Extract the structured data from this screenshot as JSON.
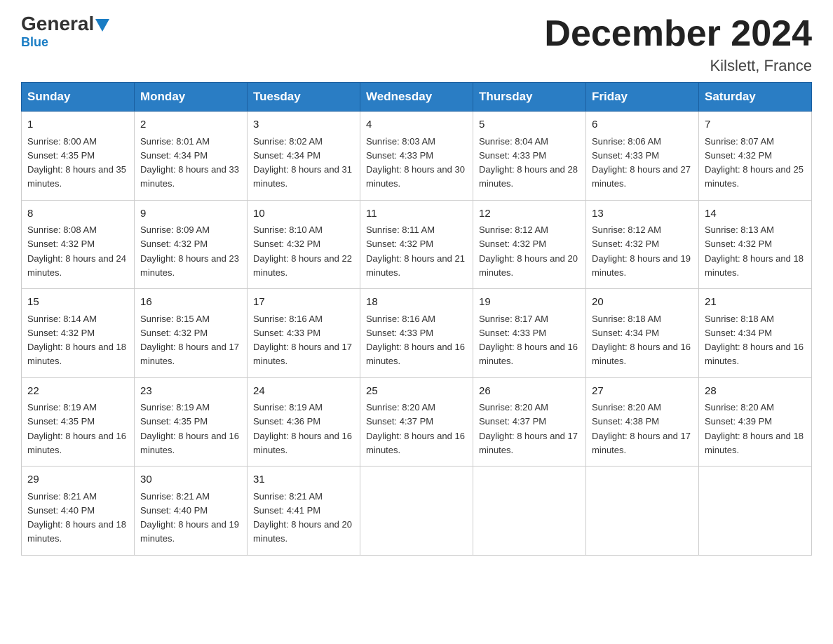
{
  "header": {
    "logo_general": "General",
    "logo_blue": "Blue",
    "month_title": "December 2024",
    "location": "Kilslett, France"
  },
  "columns": [
    "Sunday",
    "Monday",
    "Tuesday",
    "Wednesday",
    "Thursday",
    "Friday",
    "Saturday"
  ],
  "weeks": [
    [
      {
        "day": "1",
        "sunrise": "8:00 AM",
        "sunset": "4:35 PM",
        "daylight": "8 hours and 35 minutes."
      },
      {
        "day": "2",
        "sunrise": "8:01 AM",
        "sunset": "4:34 PM",
        "daylight": "8 hours and 33 minutes."
      },
      {
        "day": "3",
        "sunrise": "8:02 AM",
        "sunset": "4:34 PM",
        "daylight": "8 hours and 31 minutes."
      },
      {
        "day": "4",
        "sunrise": "8:03 AM",
        "sunset": "4:33 PM",
        "daylight": "8 hours and 30 minutes."
      },
      {
        "day": "5",
        "sunrise": "8:04 AM",
        "sunset": "4:33 PM",
        "daylight": "8 hours and 28 minutes."
      },
      {
        "day": "6",
        "sunrise": "8:06 AM",
        "sunset": "4:33 PM",
        "daylight": "8 hours and 27 minutes."
      },
      {
        "day": "7",
        "sunrise": "8:07 AM",
        "sunset": "4:32 PM",
        "daylight": "8 hours and 25 minutes."
      }
    ],
    [
      {
        "day": "8",
        "sunrise": "8:08 AM",
        "sunset": "4:32 PM",
        "daylight": "8 hours and 24 minutes."
      },
      {
        "day": "9",
        "sunrise": "8:09 AM",
        "sunset": "4:32 PM",
        "daylight": "8 hours and 23 minutes."
      },
      {
        "day": "10",
        "sunrise": "8:10 AM",
        "sunset": "4:32 PM",
        "daylight": "8 hours and 22 minutes."
      },
      {
        "day": "11",
        "sunrise": "8:11 AM",
        "sunset": "4:32 PM",
        "daylight": "8 hours and 21 minutes."
      },
      {
        "day": "12",
        "sunrise": "8:12 AM",
        "sunset": "4:32 PM",
        "daylight": "8 hours and 20 minutes."
      },
      {
        "day": "13",
        "sunrise": "8:12 AM",
        "sunset": "4:32 PM",
        "daylight": "8 hours and 19 minutes."
      },
      {
        "day": "14",
        "sunrise": "8:13 AM",
        "sunset": "4:32 PM",
        "daylight": "8 hours and 18 minutes."
      }
    ],
    [
      {
        "day": "15",
        "sunrise": "8:14 AM",
        "sunset": "4:32 PM",
        "daylight": "8 hours and 18 minutes."
      },
      {
        "day": "16",
        "sunrise": "8:15 AM",
        "sunset": "4:32 PM",
        "daylight": "8 hours and 17 minutes."
      },
      {
        "day": "17",
        "sunrise": "8:16 AM",
        "sunset": "4:33 PM",
        "daylight": "8 hours and 17 minutes."
      },
      {
        "day": "18",
        "sunrise": "8:16 AM",
        "sunset": "4:33 PM",
        "daylight": "8 hours and 16 minutes."
      },
      {
        "day": "19",
        "sunrise": "8:17 AM",
        "sunset": "4:33 PM",
        "daylight": "8 hours and 16 minutes."
      },
      {
        "day": "20",
        "sunrise": "8:18 AM",
        "sunset": "4:34 PM",
        "daylight": "8 hours and 16 minutes."
      },
      {
        "day": "21",
        "sunrise": "8:18 AM",
        "sunset": "4:34 PM",
        "daylight": "8 hours and 16 minutes."
      }
    ],
    [
      {
        "day": "22",
        "sunrise": "8:19 AM",
        "sunset": "4:35 PM",
        "daylight": "8 hours and 16 minutes."
      },
      {
        "day": "23",
        "sunrise": "8:19 AM",
        "sunset": "4:35 PM",
        "daylight": "8 hours and 16 minutes."
      },
      {
        "day": "24",
        "sunrise": "8:19 AM",
        "sunset": "4:36 PM",
        "daylight": "8 hours and 16 minutes."
      },
      {
        "day": "25",
        "sunrise": "8:20 AM",
        "sunset": "4:37 PM",
        "daylight": "8 hours and 16 minutes."
      },
      {
        "day": "26",
        "sunrise": "8:20 AM",
        "sunset": "4:37 PM",
        "daylight": "8 hours and 17 minutes."
      },
      {
        "day": "27",
        "sunrise": "8:20 AM",
        "sunset": "4:38 PM",
        "daylight": "8 hours and 17 minutes."
      },
      {
        "day": "28",
        "sunrise": "8:20 AM",
        "sunset": "4:39 PM",
        "daylight": "8 hours and 18 minutes."
      }
    ],
    [
      {
        "day": "29",
        "sunrise": "8:21 AM",
        "sunset": "4:40 PM",
        "daylight": "8 hours and 18 minutes."
      },
      {
        "day": "30",
        "sunrise": "8:21 AM",
        "sunset": "4:40 PM",
        "daylight": "8 hours and 19 minutes."
      },
      {
        "day": "31",
        "sunrise": "8:21 AM",
        "sunset": "4:41 PM",
        "daylight": "8 hours and 20 minutes."
      },
      null,
      null,
      null,
      null
    ]
  ]
}
